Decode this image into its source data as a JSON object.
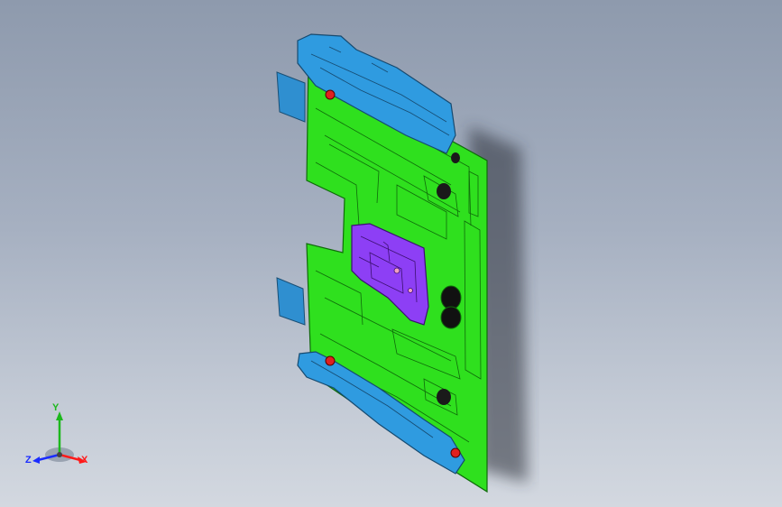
{
  "viewport": {
    "background_top": "#8e9aad",
    "background_bottom": "#d3d8e0"
  },
  "model": {
    "parts": [
      {
        "name": "base-plate",
        "color": "#2fe01e"
      },
      {
        "name": "blue-rail-top",
        "color": "#2f9be0"
      },
      {
        "name": "blue-rail-bottom",
        "color": "#2f9be0"
      },
      {
        "name": "purple-insert",
        "color": "#8d3ff5"
      },
      {
        "name": "red-guide-pins",
        "color": "#e02020"
      }
    ]
  },
  "triad": {
    "x_label": "X",
    "y_label": "Y",
    "z_label": "Z",
    "x_color": "#ff1a1a",
    "y_color": "#1db81d",
    "z_color": "#1a2cff"
  }
}
